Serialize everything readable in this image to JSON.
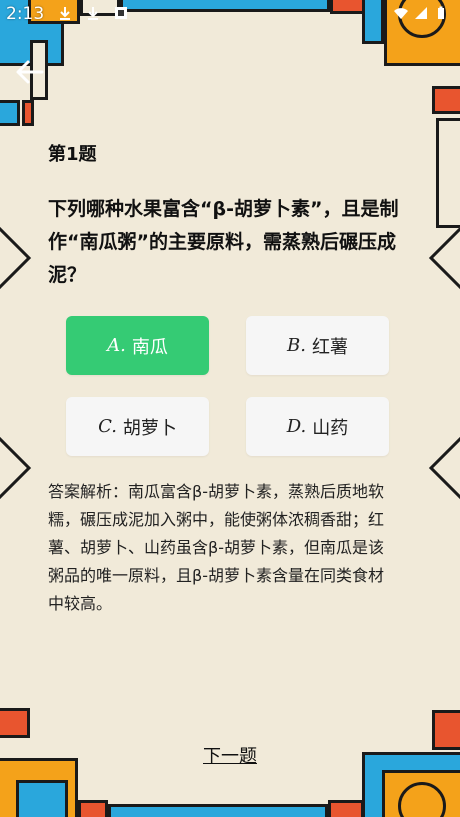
{
  "status_bar": {
    "time": "2:13"
  },
  "question": {
    "number_label": "第1题",
    "text": "下列哪种水果富含“β-胡萝卜素”，且是制作“南瓜粥”的主要原料，需蒸熟后碾压成泥？"
  },
  "options": [
    {
      "letter": "A.",
      "label": "南瓜",
      "state": "correct"
    },
    {
      "letter": "B.",
      "label": "红薯",
      "state": "default"
    },
    {
      "letter": "C.",
      "label": "胡萝卜",
      "state": "default"
    },
    {
      "letter": "D.",
      "label": "山药",
      "state": "default"
    }
  ],
  "analysis": "答案解析：南瓜富含β-胡萝卜素，蒸熟后质地软糯，碾压成泥加入粥中，能使粥体浓稠香甜；红薯、胡萝卜、山药虽含β-胡萝卜素，但南瓜是该粥品的唯一原料，且β-胡萝卜素含量在同类食材中较高。",
  "next_button": "下一题",
  "colors": {
    "correct": "#35cb74",
    "frame_blue": "#2aa7dc",
    "frame_orange": "#f4a21a",
    "frame_red": "#e8552f"
  },
  "icons": [
    "back-arrow-icon",
    "download-icon",
    "wifi-icon",
    "signal-icon",
    "battery-icon"
  ]
}
